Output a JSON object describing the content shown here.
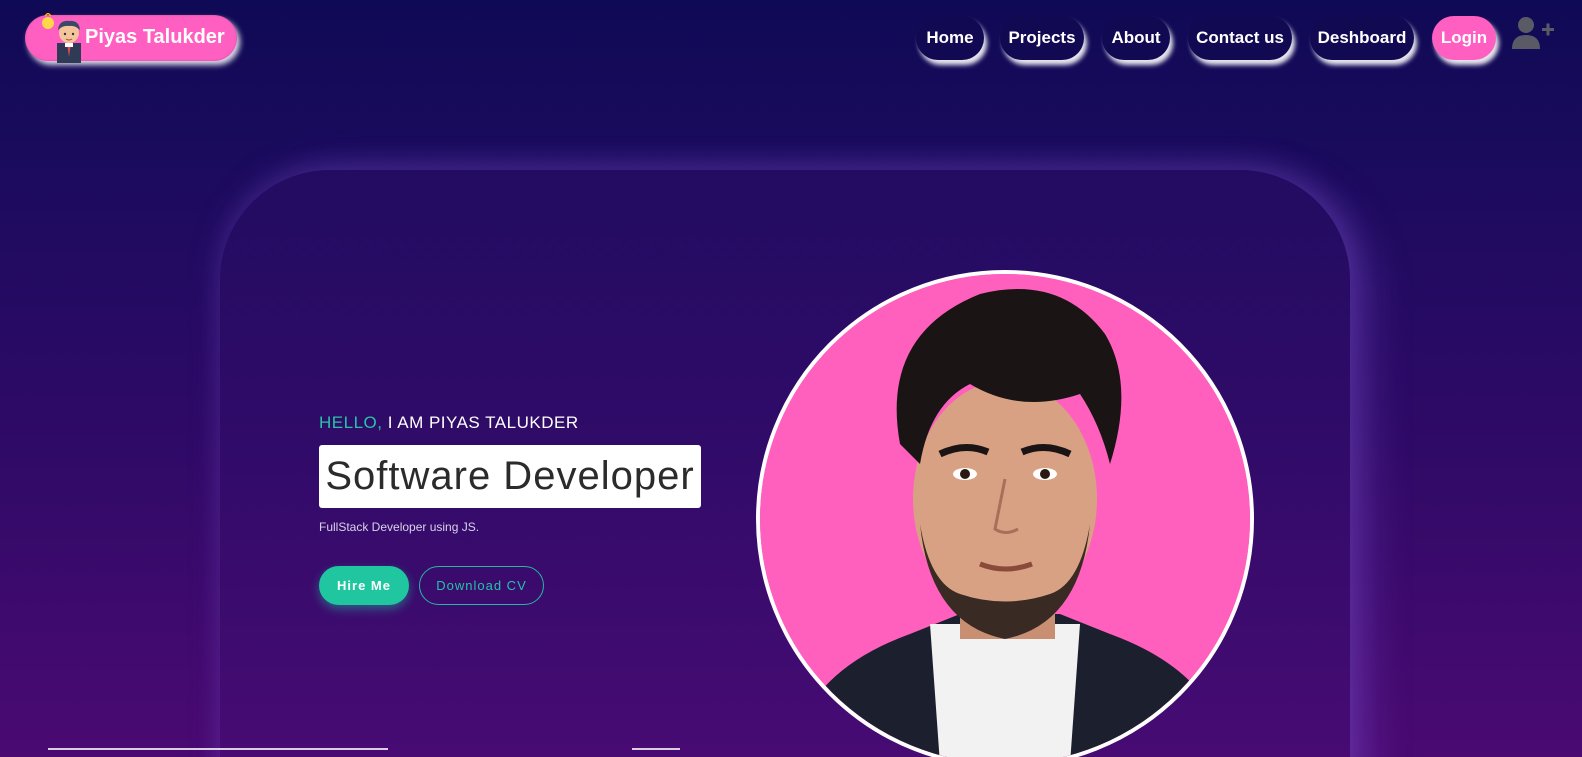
{
  "brand": {
    "name": "Piyas Talukder",
    "avatar_icon": "developer-avatar-icon"
  },
  "nav": {
    "items": [
      {
        "label": "Home"
      },
      {
        "label": "Projects"
      },
      {
        "label": "About"
      },
      {
        "label": "Contact us"
      },
      {
        "label": "Deshboard"
      },
      {
        "label": "Login"
      }
    ],
    "user_icon": "user-plus-icon"
  },
  "hero": {
    "greeting_accent": "HELLO,",
    "greeting_name": "I AM PIYAS TALUKDER",
    "role": "Software Developer",
    "subtitle": "FullStack Developer using JS.",
    "hire_button": "Hire Me",
    "cv_button": "Download CV"
  },
  "colors": {
    "accent_pink": "#ff5fc1",
    "accent_teal": "#1fc6a0",
    "nav_bg": "#110a52"
  }
}
